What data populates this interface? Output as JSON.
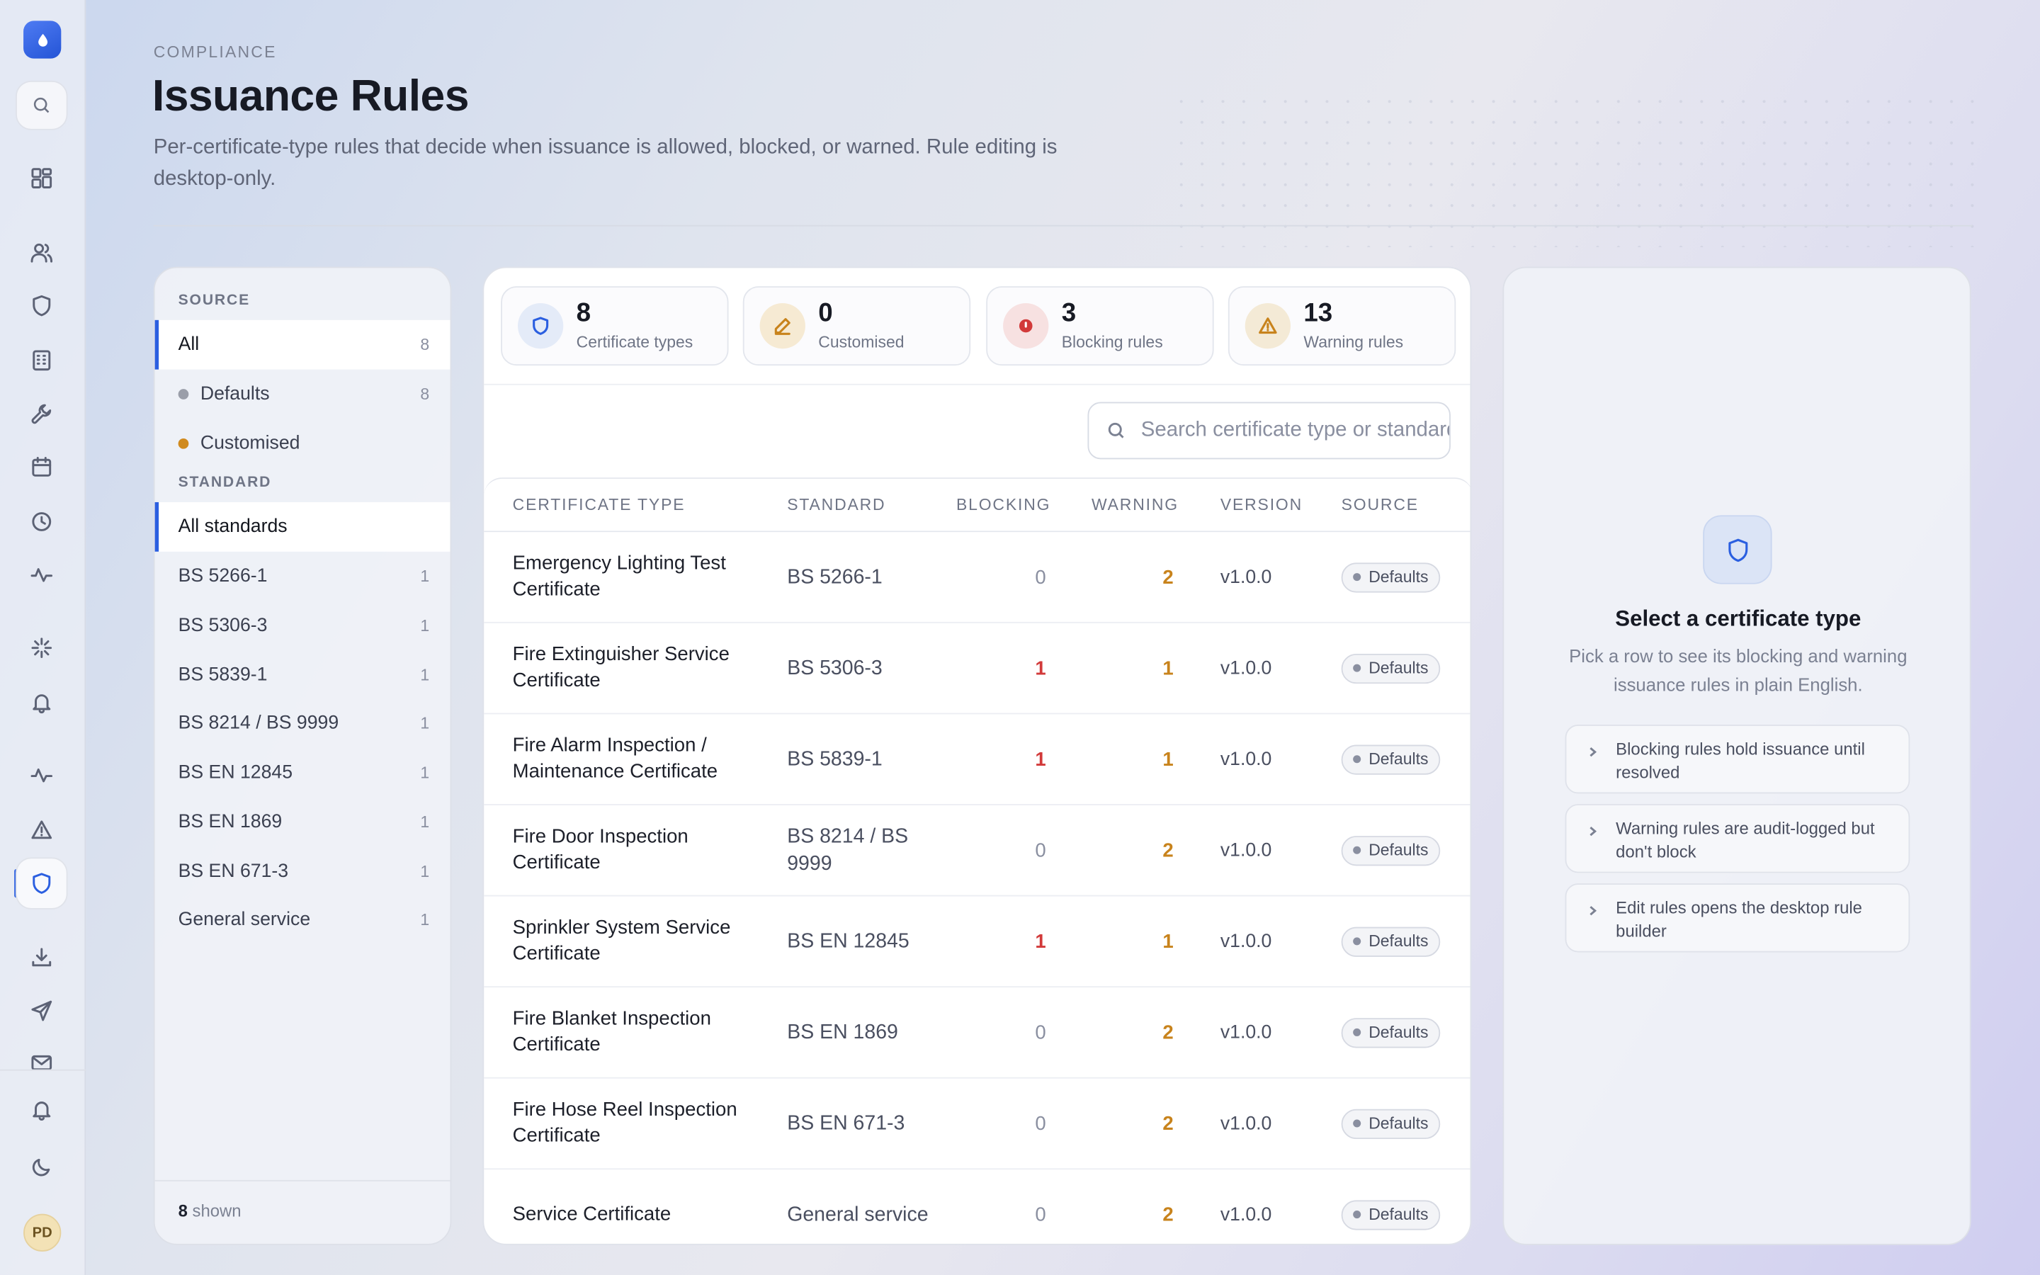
{
  "header": {
    "eyebrow": "COMPLIANCE",
    "title": "Issuance Rules",
    "subtitle": "Per-certificate-type rules that decide when issuance is allowed, blocked, or warned. Rule editing is desktop-only."
  },
  "rail": {
    "avatar_initials": "PD",
    "icons": [
      "search-icon",
      "dashboard-icon",
      "users-icon",
      "shield-icon",
      "building-icon",
      "wrench-icon",
      "calendar-icon",
      "clock-icon",
      "activity-icon",
      "sparkle-icon",
      "bell-icon",
      "pulse-icon",
      "alert-icon",
      "shield-active-icon",
      "download-icon",
      "send-icon",
      "mail-icon",
      "bell-icon",
      "moon-icon"
    ]
  },
  "filters": {
    "source_heading": "SOURCE",
    "source_items": [
      {
        "label": "All",
        "count": "8"
      },
      {
        "label": "Defaults",
        "count": "8"
      },
      {
        "label": "Customised",
        "count": ""
      }
    ],
    "standard_heading": "STANDARD",
    "standard_items": [
      {
        "label": "All standards",
        "count": ""
      },
      {
        "label": "BS 5266-1",
        "count": "1"
      },
      {
        "label": "BS 5306-3",
        "count": "1"
      },
      {
        "label": "BS 5839-1",
        "count": "1"
      },
      {
        "label": "BS 8214 / BS 9999",
        "count": "1"
      },
      {
        "label": "BS EN 12845",
        "count": "1"
      },
      {
        "label": "BS EN 1869",
        "count": "1"
      },
      {
        "label": "BS EN 671-3",
        "count": "1"
      },
      {
        "label": "General service",
        "count": "1"
      }
    ],
    "footer_count": "8",
    "footer_label": " shown"
  },
  "stats": [
    {
      "value": "8",
      "label": "Certificate types"
    },
    {
      "value": "0",
      "label": "Customised"
    },
    {
      "value": "3",
      "label": "Blocking rules"
    },
    {
      "value": "13",
      "label": "Warning rules"
    }
  ],
  "search": {
    "placeholder": "Search certificate type or standard",
    "value": ""
  },
  "table": {
    "columns": [
      "CERTIFICATE TYPE",
      "STANDARD",
      "BLOCKING",
      "WARNING",
      "VERSION",
      "SOURCE"
    ],
    "rows": [
      {
        "type": "Emergency Lighting Test Certificate",
        "standard": "BS 5266-1",
        "blocking": "0",
        "warning": "2",
        "version": "v1.0.0",
        "source": "Defaults"
      },
      {
        "type": "Fire Extinguisher Service Certificate",
        "standard": "BS 5306-3",
        "blocking": "1",
        "warning": "1",
        "version": "v1.0.0",
        "source": "Defaults"
      },
      {
        "type": "Fire Alarm Inspection / Maintenance Certificate",
        "standard": "BS 5839-1",
        "blocking": "1",
        "warning": "1",
        "version": "v1.0.0",
        "source": "Defaults"
      },
      {
        "type": "Fire Door Inspection Certificate",
        "standard": "BS 8214 / BS 9999",
        "blocking": "0",
        "warning": "2",
        "version": "v1.0.0",
        "source": "Defaults"
      },
      {
        "type": "Sprinkler System Service Certificate",
        "standard": "BS EN 12845",
        "blocking": "1",
        "warning": "1",
        "version": "v1.0.0",
        "source": "Defaults"
      },
      {
        "type": "Fire Blanket Inspection Certificate",
        "standard": "BS EN 1869",
        "blocking": "0",
        "warning": "2",
        "version": "v1.0.0",
        "source": "Defaults"
      },
      {
        "type": "Fire Hose Reel Inspection Certificate",
        "standard": "BS EN 671-3",
        "blocking": "0",
        "warning": "2",
        "version": "v1.0.0",
        "source": "Defaults"
      },
      {
        "type": "Service Certificate",
        "standard": "General service",
        "blocking": "0",
        "warning": "2",
        "version": "v1.0.0",
        "source": "Defaults"
      }
    ]
  },
  "detail": {
    "title": "Select a certificate type",
    "subtitle": "Pick a row to see its blocking and warning issuance rules in plain English.",
    "hints": [
      "Blocking rules hold issuance until resolved",
      "Warning rules are audit-logged but don't block",
      "Edit rules opens the desktop rule builder"
    ]
  },
  "colors": {
    "accent": "#2b5fe0",
    "blocking": "#d23a3a",
    "warning": "#c8831c",
    "customised_dot": "#d08a1e",
    "defaults_dot": "#9a9ea9"
  }
}
